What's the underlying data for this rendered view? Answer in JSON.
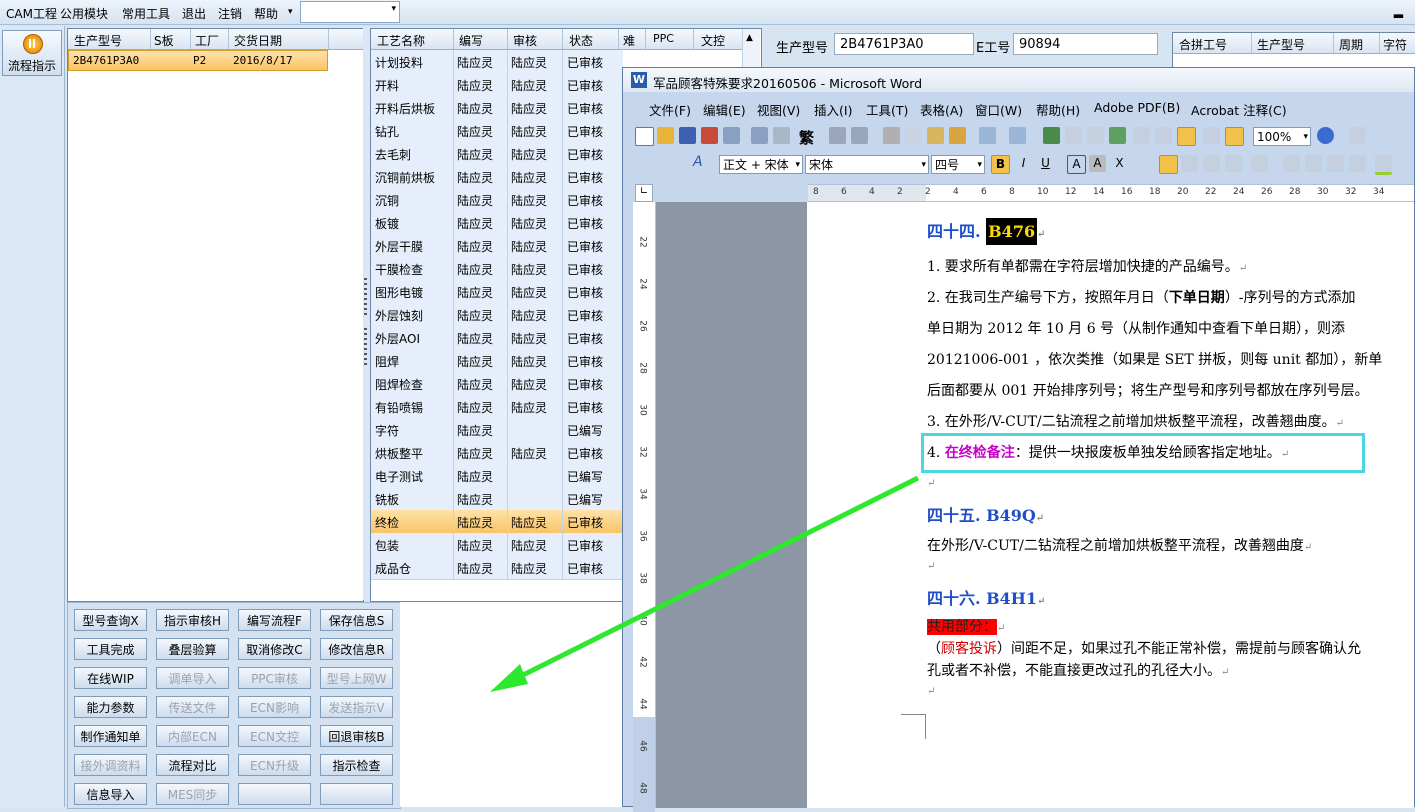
{
  "menu": {
    "items": [
      "CAM工程",
      "公用模块",
      "常用工具",
      "退出",
      "注销",
      "帮助"
    ],
    "dropdown_arrow": "▾",
    "combo_value": "",
    "minimize": "▂"
  },
  "leftbar": {
    "flow_button": "流程指示"
  },
  "product_grid": {
    "headers": [
      "生产型号",
      "S板",
      "工厂",
      "交货日期"
    ],
    "row": {
      "model": "2B4761P3A0",
      "s": "",
      "factory": "P2",
      "date": "2016/8/17"
    }
  },
  "process_grid": {
    "headers": [
      "工艺名称",
      "编写",
      "审核",
      "状态",
      "难",
      "PPC",
      "文控"
    ],
    "rows": [
      {
        "name": "计划投料",
        "writer": "陆应灵",
        "reviewer": "陆应灵",
        "status": "已审核"
      },
      {
        "name": "开料",
        "writer": "陆应灵",
        "reviewer": "陆应灵",
        "status": "已审核"
      },
      {
        "name": "开料后烘板",
        "writer": "陆应灵",
        "reviewer": "陆应灵",
        "status": "已审核"
      },
      {
        "name": "钻孔",
        "writer": "陆应灵",
        "reviewer": "陆应灵",
        "status": "已审核"
      },
      {
        "name": "去毛刺",
        "writer": "陆应灵",
        "reviewer": "陆应灵",
        "status": "已审核"
      },
      {
        "name": "沉铜前烘板",
        "writer": "陆应灵",
        "reviewer": "陆应灵",
        "status": "已审核"
      },
      {
        "name": "沉铜",
        "writer": "陆应灵",
        "reviewer": "陆应灵",
        "status": "已审核"
      },
      {
        "name": "板镀",
        "writer": "陆应灵",
        "reviewer": "陆应灵",
        "status": "已审核"
      },
      {
        "name": "外层干膜",
        "writer": "陆应灵",
        "reviewer": "陆应灵",
        "status": "已审核"
      },
      {
        "name": "干膜检查",
        "writer": "陆应灵",
        "reviewer": "陆应灵",
        "status": "已审核"
      },
      {
        "name": "图形电镀",
        "writer": "陆应灵",
        "reviewer": "陆应灵",
        "status": "已审核"
      },
      {
        "name": "外层蚀刻",
        "writer": "陆应灵",
        "reviewer": "陆应灵",
        "status": "已审核"
      },
      {
        "name": "外层AOI",
        "writer": "陆应灵",
        "reviewer": "陆应灵",
        "status": "已审核"
      },
      {
        "name": "阻焊",
        "writer": "陆应灵",
        "reviewer": "陆应灵",
        "status": "已审核"
      },
      {
        "name": "阻焊检查",
        "writer": "陆应灵",
        "reviewer": "陆应灵",
        "status": "已审核"
      },
      {
        "name": "有铅喷锡",
        "writer": "陆应灵",
        "reviewer": "陆应灵",
        "status": "已审核"
      },
      {
        "name": "字符",
        "writer": "陆应灵",
        "reviewer": "",
        "status": "已编写"
      },
      {
        "name": "烘板整平",
        "writer": "陆应灵",
        "reviewer": "陆应灵",
        "status": "已审核"
      },
      {
        "name": "电子测试",
        "writer": "陆应灵",
        "reviewer": "",
        "status": "已编写"
      },
      {
        "name": "铣板",
        "writer": "陆应灵",
        "reviewer": "",
        "status": "已编写"
      },
      {
        "name": "终检",
        "writer": "陆应灵",
        "reviewer": "陆应灵",
        "status": "已审核",
        "selected": true
      },
      {
        "name": "包装",
        "writer": "陆应灵",
        "reviewer": "陆应灵",
        "status": "已审核"
      },
      {
        "name": "成品仓",
        "writer": "陆应灵",
        "reviewer": "陆应灵",
        "status": "已审核"
      }
    ]
  },
  "buttons": [
    [
      {
        "label": "型号查询X",
        "enabled": true
      },
      {
        "label": "指示审核H",
        "enabled": true
      },
      {
        "label": "编写流程F",
        "enabled": true
      },
      {
        "label": "保存信息S",
        "enabled": true
      }
    ],
    [
      {
        "label": "工具完成",
        "enabled": true
      },
      {
        "label": "叠层验算",
        "enabled": true
      },
      {
        "label": "取消修改C",
        "enabled": true
      },
      {
        "label": "修改信息R",
        "enabled": true
      }
    ],
    [
      {
        "label": "在线WIP",
        "enabled": true
      },
      {
        "label": "调单导入",
        "enabled": false
      },
      {
        "label": "PPC审核",
        "enabled": false
      },
      {
        "label": "型号上网W",
        "enabled": false
      }
    ],
    [
      {
        "label": "能力参数",
        "enabled": true
      },
      {
        "label": "传送文件",
        "enabled": false
      },
      {
        "label": "ECN影响",
        "enabled": false
      },
      {
        "label": "发送指示V",
        "enabled": false
      }
    ],
    [
      {
        "label": "制作通知单",
        "enabled": true
      },
      {
        "label": "内部ECN",
        "enabled": false
      },
      {
        "label": "ECN文控",
        "enabled": false
      },
      {
        "label": "回退审核B",
        "enabled": true
      }
    ],
    [
      {
        "label": "接外调资料",
        "enabled": false
      },
      {
        "label": "流程对比",
        "enabled": true
      },
      {
        "label": "ECN升级",
        "enabled": false
      },
      {
        "label": "指示检查",
        "enabled": true
      }
    ],
    [
      {
        "label": "信息导入",
        "enabled": true
      },
      {
        "label": "MES同步",
        "enabled": false
      },
      {
        "label": "",
        "enabled": true
      },
      {
        "label": "",
        "enabled": true
      }
    ]
  ],
  "info": {
    "model_label": "生产型号",
    "model_value": "2B4761P3A0",
    "work_label": "E工号",
    "work_value": "90894",
    "combine_headers": [
      "合拼工号",
      "生产型号",
      "周期",
      "字符"
    ]
  },
  "word": {
    "title": "军品顾客特殊要求20160506 - Microsoft Word",
    "menus": [
      "文件(F)",
      "编辑(E)",
      "视图(V)",
      "插入(I)",
      "工具(T)",
      "表格(A)",
      "窗口(W)",
      "帮助(H)",
      "Adobe PDF(B)",
      "Acrobat 注释(C)"
    ],
    "zoom": "100%",
    "style": "正文 + 宋体",
    "font": "宋体",
    "size": "四号",
    "trad": "繁",
    "ruler_numbers": [
      "8",
      "6",
      "4",
      "2",
      "2",
      "4",
      "6",
      "8",
      "10",
      "12",
      "14",
      "16",
      "18",
      "20",
      "22",
      "24",
      "26",
      "28",
      "30",
      "32",
      "34"
    ],
    "vruler_numbers": [
      "22",
      "24",
      "26",
      "28",
      "30",
      "32",
      "34",
      "36",
      "38",
      "40",
      "42",
      "44",
      "46",
      "48"
    ],
    "doc": {
      "h44_num": "四十四.",
      "h44_code": "B476",
      "l1": "1. 要求所有单都需在字符层增加快捷的产品编号。",
      "l2a": "2. 在我司生产编号下方，按照年月日（",
      "l2b": "下单日期",
      "l2c": "）-序列号的方式添加",
      "l3": "单日期为 2012 年 10 月 6 号（从制作通知中查看下单日期），则添",
      "l4": "20121006-001 ，依次类推（如果是 SET 拼板，则每 unit 都加），新单",
      "l5": "后面都要从 001 开始排序列号；将生产型号和序列号都放在序列号层。",
      "l6": "3. 在外形/V-CUT/二钻流程之前增加烘板整平流程，改善翘曲度。",
      "l7a": "4. ",
      "l7b": "在终检备注",
      "l7c": "：提供一块报废板单独发给顾客指定地址。",
      "h45": "四十五. B49Q",
      "l8": "在外形/V-CUT/二钻流程之前增加烘板整平流程，改善翘曲度",
      "h46": "四十六. B4H1",
      "l9": "共用部分：",
      "l10a": "（",
      "l10b": "顾客投诉",
      "l10c": "）间距不足，如果过孔不能正常补偿，需提前与顾客确认允",
      "l11": "孔或者不补偿，不能直接更改过孔的孔径大小。"
    }
  },
  "colors": {
    "accent": "#1f4ec8",
    "magenta": "#c800c8",
    "red_fill": "#ff0000",
    "teal_box": "#4ad7e0",
    "arrow": "#2ee82e"
  }
}
